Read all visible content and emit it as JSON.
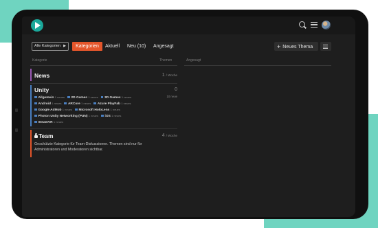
{
  "nav": {
    "all_categories": "Alle Kategorien",
    "tabs": [
      "Kategorien",
      "Aktuell",
      "Neu (10)",
      "Angesagt"
    ],
    "new_topic": "Neues Thema"
  },
  "table": {
    "col_category": "Kategorie",
    "col_topics": "Themen",
    "col_trending": "Angesagt"
  },
  "categories": {
    "news": {
      "title": "News",
      "count": "1",
      "period": "/ Woche",
      "color": "#9b59b6"
    },
    "unity": {
      "title": "Unity",
      "count": "0",
      "posts": "10 neue",
      "color": "#4a7fc0",
      "subcategories": [
        {
          "name": "Allgemein",
          "new": "1 neues"
        },
        {
          "name": "2D Games",
          "new": "1 neues"
        },
        {
          "name": "3D Games",
          "new": "1 neues"
        },
        {
          "name": "Android",
          "new": "1 neues"
        },
        {
          "name": "ARCore",
          "new": "1 neues"
        },
        {
          "name": "Azure PlayFab",
          "new": "1 neues"
        },
        {
          "name": "Google AdMob",
          "new": "1 neues"
        },
        {
          "name": "Microsoft HoloLens",
          "new": "1 neues"
        },
        {
          "name": "Photon Unity Networking (PUN)",
          "new": "1 neues"
        },
        {
          "name": "iOS",
          "new": "1 neues"
        },
        {
          "name": "SteamVR",
          "new": "1 neues"
        }
      ]
    },
    "team": {
      "title": "Team",
      "count": "4",
      "period": "/ Woche",
      "color": "#e4562b",
      "description": "Geschützte Kategorie für Team-Diskussionen. Themen sind nur für Administratoren und Moderatoren sichtbar."
    }
  },
  "colors": {
    "accent": "#e4562b",
    "brand": "#6fd4c0"
  },
  "icons": [
    "logo-icon",
    "search-icon",
    "menu-icon",
    "avatar",
    "plus-icon",
    "lock-icon"
  ]
}
